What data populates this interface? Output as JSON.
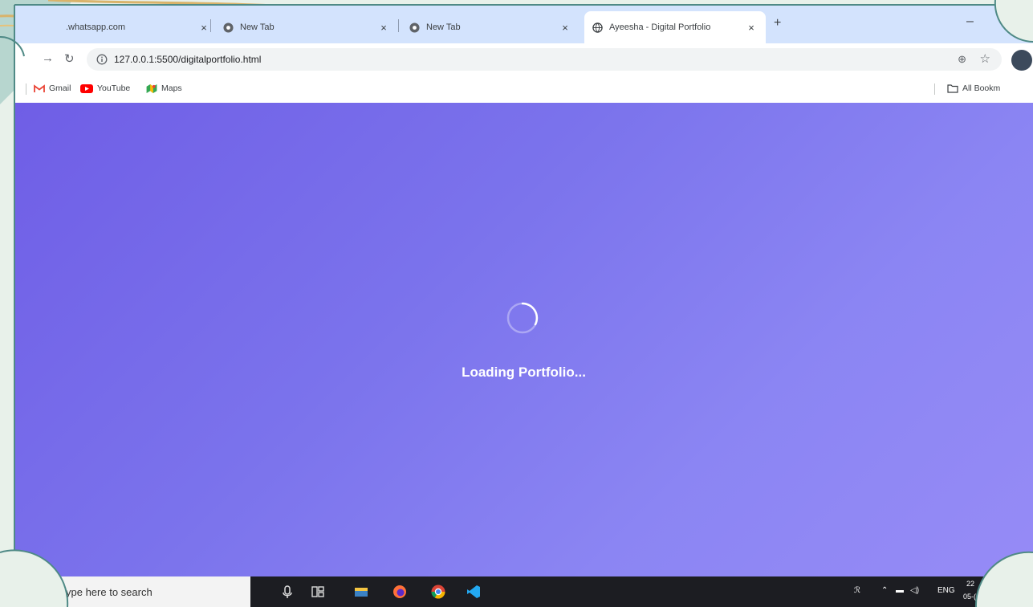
{
  "tabs": [
    {
      "label": ".whatsapp.com",
      "close": "×",
      "active": false
    },
    {
      "label": "New Tab",
      "close": "×",
      "active": false
    },
    {
      "label": "New Tab",
      "close": "×",
      "active": false
    },
    {
      "label": "Ayeesha - Digital Portfolio",
      "close": "×",
      "active": true
    }
  ],
  "new_tab": "+",
  "window_control": "–",
  "toolbar": {
    "url": "127.0.0.1:5500/digitalportfolio.html"
  },
  "bookmarks": [
    {
      "label": "Gmail",
      "icon": "gmail-icon"
    },
    {
      "label": "YouTube",
      "icon": "youtube-icon"
    },
    {
      "label": "Maps",
      "icon": "maps-icon"
    }
  ],
  "all_bookmarks": "All Bookm",
  "page": {
    "loading_text": "Loading Portfolio..."
  },
  "taskbar": {
    "search_placeholder": "ype here to search",
    "language": "ENG",
    "time": "22",
    "date": "05-("
  },
  "colors": {
    "gradient_start": "#6f5ee6",
    "gradient_end": "#968bf6",
    "tab_strip": "#d3e3fd",
    "frame_border": "#4f8a86"
  }
}
